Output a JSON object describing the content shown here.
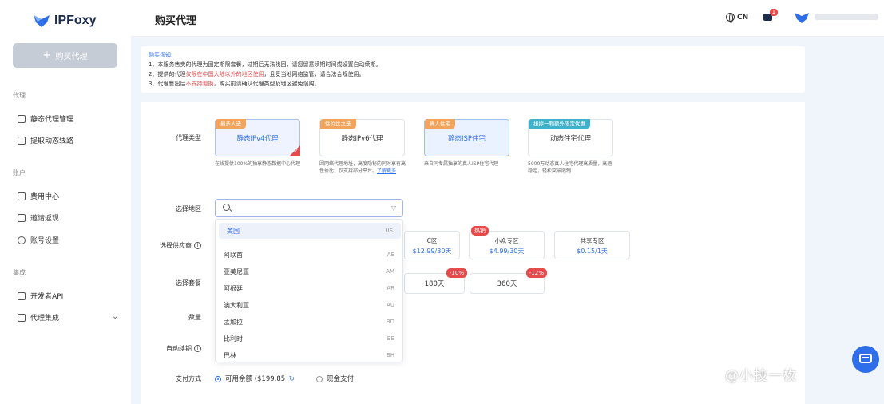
{
  "brand": {
    "name": "IPFoxy"
  },
  "sidebar": {
    "buy_button": "购买代理",
    "sections": [
      {
        "label": "代理",
        "items": [
          {
            "label": "静态代理管理",
            "icon": "monitor-icon"
          },
          {
            "label": "提取动态线路",
            "icon": "list-icon"
          }
        ]
      },
      {
        "label": "账户",
        "items": [
          {
            "label": "费用中心",
            "icon": "wallet-icon"
          },
          {
            "label": "邀请返现",
            "icon": "gift-icon"
          },
          {
            "label": "账号设置",
            "icon": "settings-icon"
          }
        ]
      },
      {
        "label": "集成",
        "items": [
          {
            "label": "开发者API",
            "icon": "code-icon"
          },
          {
            "label": "代理集成",
            "icon": "integration-icon"
          }
        ]
      }
    ]
  },
  "header": {
    "title": "购买代理",
    "lang": "CN",
    "msg_count": "1"
  },
  "notice": {
    "title": "购买须知:",
    "line1": "1、本服务售卖的代理为固定期限套餐，过期后无法找回，请您留意续期时间或设置自动续期。",
    "line2_a": "2、提供的代理",
    "line2_red": "仅限在中国大陆以外的地区使用",
    "line2_b": "，且受当地网络监管，请合法合规使用。",
    "line3_a": "3、代理售出后",
    "line3_red": "不支持退换",
    "line3_b": "，购买前请确认代理类型及地区避免误购。"
  },
  "form": {
    "labels": {
      "proxy_type": "代理类型",
      "region": "选择地区",
      "provider": "选择供应商",
      "package": "选择套餐",
      "quantity": "数量",
      "auto_renew": "自动续期",
      "payment": "支付方式"
    },
    "proxy_types": [
      {
        "tag": "最多人选",
        "name": "静态IPv4代理",
        "desc": "在线提供100%的独享静态数据中心代理"
      },
      {
        "tag": "性价比之选",
        "name": "静态IPv6代理",
        "desc": "因网络代理地址，高度隐秘的同时享有高性价比，仅支持部分平台。",
        "more": "了解更多"
      },
      {
        "tag": "真人住宅",
        "name": "静态ISP住宅",
        "desc": "来自同专属独享的真人ISP住宅代理"
      },
      {
        "tag": "拔掉一颗额外限定优惠",
        "name": "动态住宅代理",
        "desc": "5000万动态真人住宅代理高质量，高速稳定，轻松突破限制"
      }
    ],
    "providers": [
      {
        "name": "C区",
        "price": "$12.99/30天"
      },
      {
        "name": "小众专区",
        "price": "$4.99/30天",
        "badge": "热销"
      },
      {
        "name": "共享专区",
        "price": "$0.15/1天"
      }
    ],
    "packages": [
      {
        "name": "180天",
        "badge": "-10%"
      },
      {
        "name": "360天",
        "badge": "-12%"
      }
    ],
    "payment": {
      "balance_label": "可用余额 ($199.85",
      "cash_label": "现金支付"
    }
  },
  "region_dropdown": {
    "search_value": "|",
    "items": [
      {
        "name": "美国",
        "code": "US"
      },
      {
        "name": "阿联酋",
        "code": "AE"
      },
      {
        "name": "亚美尼亚",
        "code": "AM"
      },
      {
        "name": "阿根廷",
        "code": "AR"
      },
      {
        "name": "澳大利亚",
        "code": "AU"
      },
      {
        "name": "孟加拉",
        "code": "BD"
      },
      {
        "name": "比利时",
        "code": "BE"
      },
      {
        "name": "巴林",
        "code": "BH"
      }
    ]
  },
  "watermark": "@小技一枚",
  "colors": {
    "accent": "#2e6ee8",
    "danger": "#e54b4b",
    "sidebar_bg": "#ffffff",
    "page_bg": "#f0f4fb"
  }
}
